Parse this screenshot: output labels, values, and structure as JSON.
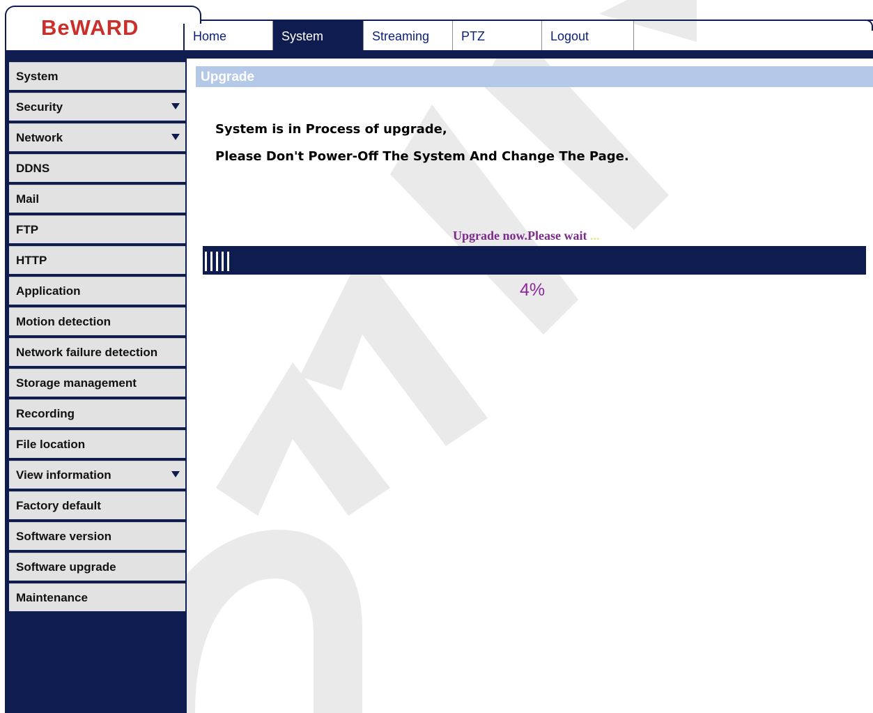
{
  "brand": {
    "logo_text": "BeWARD"
  },
  "nav": {
    "tabs": [
      {
        "label": "Home",
        "active": false
      },
      {
        "label": "System",
        "active": true
      },
      {
        "label": "Streaming",
        "active": false
      },
      {
        "label": "PTZ",
        "active": false
      },
      {
        "label": "Logout",
        "active": false
      }
    ]
  },
  "sidebar": {
    "items": [
      {
        "label": "System",
        "dropdown": false
      },
      {
        "label": "Security",
        "dropdown": true
      },
      {
        "label": "Network",
        "dropdown": true
      },
      {
        "label": "DDNS",
        "dropdown": false
      },
      {
        "label": "Mail",
        "dropdown": false
      },
      {
        "label": "FTP",
        "dropdown": false
      },
      {
        "label": "HTTP",
        "dropdown": false
      },
      {
        "label": "Application",
        "dropdown": false
      },
      {
        "label": "Motion detection",
        "dropdown": false
      },
      {
        "label": "Network failure detection",
        "dropdown": false
      },
      {
        "label": "Storage management",
        "dropdown": false
      },
      {
        "label": "Recording",
        "dropdown": false
      },
      {
        "label": "File location",
        "dropdown": false
      },
      {
        "label": "View information",
        "dropdown": true
      },
      {
        "label": "Factory default",
        "dropdown": false
      },
      {
        "label": "Software version",
        "dropdown": false
      },
      {
        "label": "Software upgrade",
        "dropdown": false
      },
      {
        "label": "Maintenance",
        "dropdown": false
      }
    ]
  },
  "main": {
    "section_title": "Upgrade",
    "message_line1": "System is in Process of upgrade,",
    "message_line2": "Please Don't Power-Off The System And Change The Page.",
    "wait_text": "Upgrade now.Please wait",
    "wait_dots": "...",
    "progress_fraction": 0.04,
    "progress_label": "4%"
  },
  "colors": {
    "navy": "#0f1c4f",
    "section_bar": "#b4c8e8",
    "logo_red": "#c9302c",
    "wait_text": "#7b2a8c"
  }
}
